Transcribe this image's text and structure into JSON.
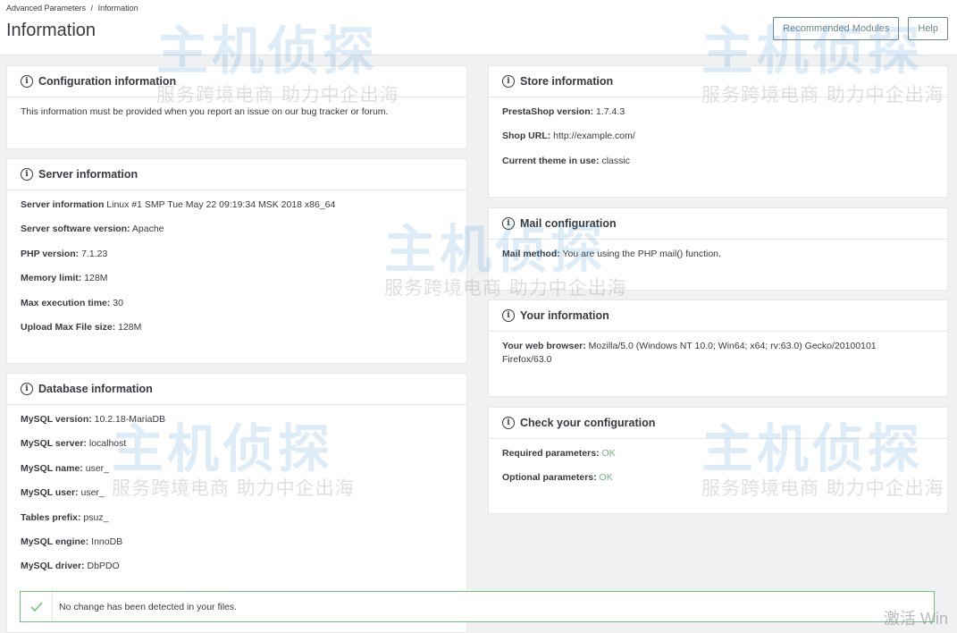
{
  "header": {
    "breadcrumb": [
      "Advanced Parameters",
      "/",
      "Information"
    ],
    "title": "Information",
    "buttons": {
      "recommended": "Recommended Modules",
      "help": "Help"
    }
  },
  "config": {
    "title": "Configuration information",
    "text": "This information must be provided when you report an issue on our bug tracker or forum."
  },
  "server": {
    "title": "Server information",
    "rows": [
      {
        "label": "Server information",
        "value": "Linux #1 SMP Tue May 22 09:19:34 MSK 2018 x86_64"
      },
      {
        "label": "Server software version:",
        "value": "Apache"
      },
      {
        "label": "PHP version:",
        "value": "7.1.23"
      },
      {
        "label": "Memory limit:",
        "value": "128M"
      },
      {
        "label": "Max execution time:",
        "value": "30"
      },
      {
        "label": "Upload Max File size:",
        "value": "128M"
      }
    ]
  },
  "database": {
    "title": "Database information",
    "rows": [
      {
        "label": "MySQL version:",
        "value": "10.2.18-MariaDB"
      },
      {
        "label": "MySQL server:",
        "value": "localhost"
      },
      {
        "label": "MySQL name:",
        "value": "user_"
      },
      {
        "label": "MySQL user:",
        "value": "user_"
      },
      {
        "label": "Tables prefix:",
        "value": "psuz_"
      },
      {
        "label": "MySQL engine:",
        "value": "InnoDB"
      },
      {
        "label": "MySQL driver:",
        "value": "DbPDO"
      }
    ]
  },
  "store": {
    "title": "Store information",
    "rows": [
      {
        "label": "PrestaShop version:",
        "value": "1.7.4.3"
      },
      {
        "label": "Shop URL:",
        "value": "http://example.com/"
      },
      {
        "label": "Current theme in use:",
        "value": "classic"
      }
    ]
  },
  "mail": {
    "title": "Mail configuration",
    "rows": [
      {
        "label": "Mail method:",
        "value": "You are using the PHP mail() function."
      }
    ]
  },
  "you": {
    "title": "Your information",
    "rows": [
      {
        "label": "Your web browser:",
        "value": "Mozilla/5.0 (Windows NT 10.0; Win64; x64; rv:63.0) Gecko/20100101 Firefox/63.0"
      }
    ]
  },
  "check": {
    "title": "Check your configuration",
    "rows": [
      {
        "label": "Required parameters:",
        "value": "OK"
      },
      {
        "label": "Optional parameters:",
        "value": "OK"
      }
    ]
  },
  "alert": {
    "text": "No change has been detected in your files."
  },
  "watermark": {
    "brand": "主机侦探",
    "slogan": "服务跨境电商 助力中企出海"
  },
  "os_overlay": {
    "text": "激活 Win"
  }
}
